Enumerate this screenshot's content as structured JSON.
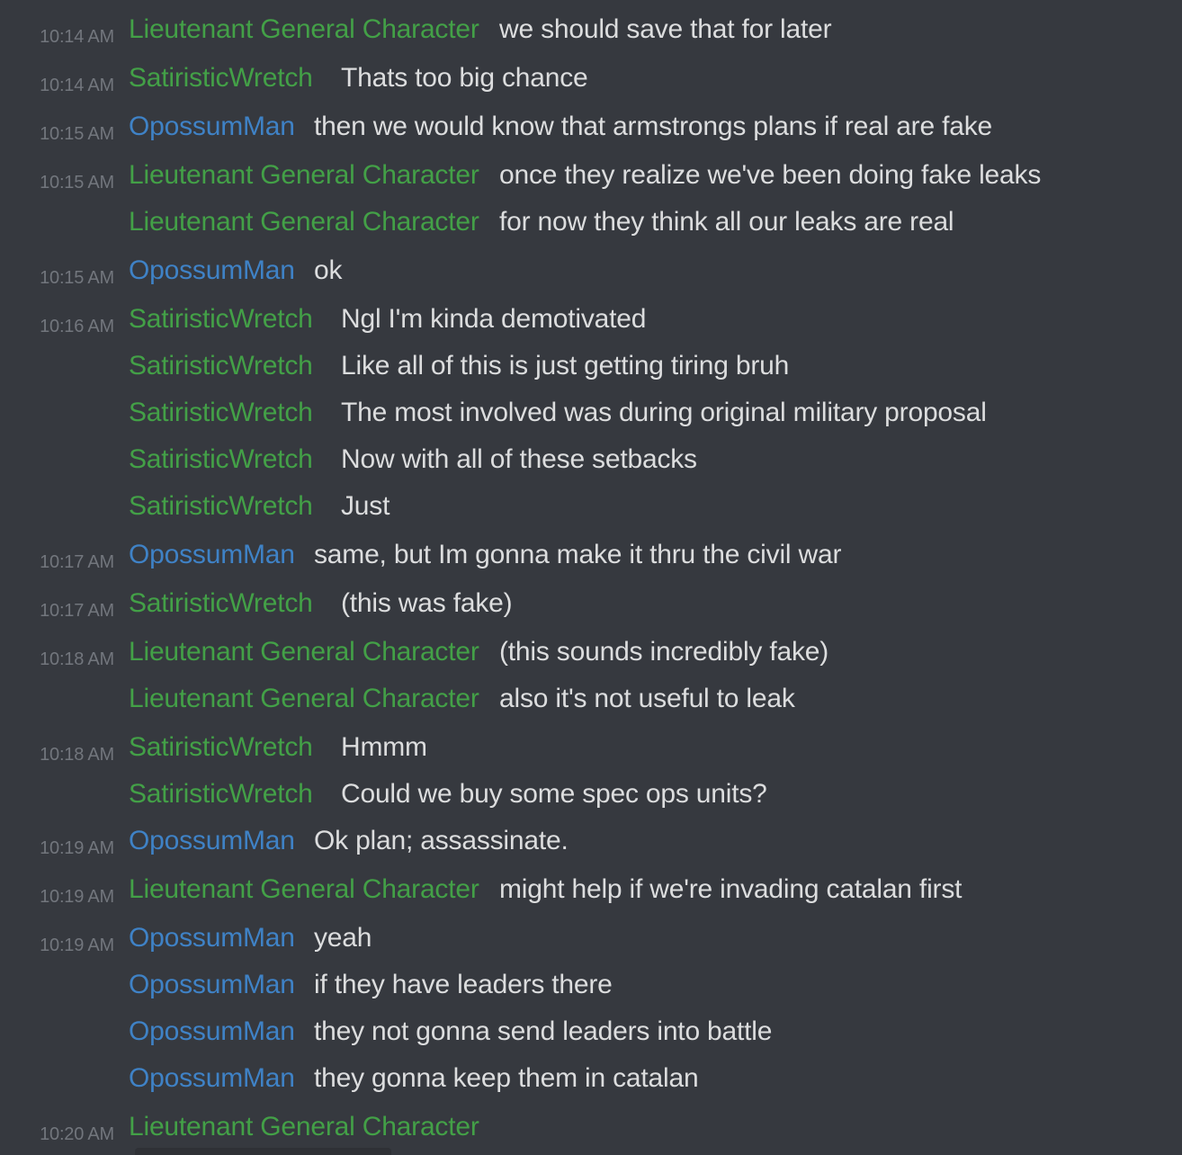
{
  "colors": {
    "background": "#36393f",
    "green_author": "#43a047",
    "blue_author": "#3f82c6",
    "timestamp": "#72767d",
    "text": "#dcddde"
  },
  "messages": [
    {
      "time": "10:14 AM",
      "author": "Lieutenant General Character",
      "color": "#43a047",
      "text": "we should save that for later"
    },
    {
      "time": "10:14 AM",
      "author": "SatiristicWretch",
      "color": "#43a047",
      "text": "Thats too big chance"
    },
    {
      "time": "10:15 AM",
      "author": "OpossumMan",
      "color": "#3f82c6",
      "text": "then we would know that armstrongs plans if real are fake"
    },
    {
      "time": "10:15 AM",
      "author": "Lieutenant General Character",
      "color": "#43a047",
      "text": "once they realize we've been doing fake leaks"
    },
    {
      "time": "",
      "author": "Lieutenant General Character",
      "color": "#43a047",
      "text": "for now they think all our leaks are real"
    },
    {
      "time": "10:15 AM",
      "author": "OpossumMan",
      "color": "#3f82c6",
      "text": "ok"
    },
    {
      "time": "10:16 AM",
      "author": "SatiristicWretch",
      "color": "#43a047",
      "text": "Ngl I'm kinda demotivated"
    },
    {
      "time": "",
      "author": "SatiristicWretch",
      "color": "#43a047",
      "text": "Like all of this is just getting tiring bruh"
    },
    {
      "time": "",
      "author": "SatiristicWretch",
      "color": "#43a047",
      "text": "The most involved was during original military proposal"
    },
    {
      "time": "",
      "author": "SatiristicWretch",
      "color": "#43a047",
      "text": "Now with all of these setbacks"
    },
    {
      "time": "",
      "author": "SatiristicWretch",
      "color": "#43a047",
      "text": "Just"
    },
    {
      "time": "10:17 AM",
      "author": "OpossumMan",
      "color": "#3f82c6",
      "text": "same, but Im gonna make it thru the civil war"
    },
    {
      "time": "10:17 AM",
      "author": "SatiristicWretch",
      "color": "#43a047",
      "text": "(this was fake)"
    },
    {
      "time": "10:18 AM",
      "author": "Lieutenant General Character",
      "color": "#43a047",
      "text": "(this sounds incredibly fake)"
    },
    {
      "time": "",
      "author": "Lieutenant General Character",
      "color": "#43a047",
      "text": "also it's not useful to leak"
    },
    {
      "time": "10:18 AM",
      "author": "SatiristicWretch",
      "color": "#43a047",
      "text": "Hmmm"
    },
    {
      "time": "",
      "author": "SatiristicWretch",
      "color": "#43a047",
      "text": "Could we buy some spec ops units?"
    },
    {
      "time": "10:19 AM",
      "author": "OpossumMan",
      "color": "#3f82c6",
      "text": "Ok plan; assassinate."
    },
    {
      "time": "10:19 AM",
      "author": "Lieutenant General Character",
      "color": "#43a047",
      "text": "might help if we're invading catalan first"
    },
    {
      "time": "10:19 AM",
      "author": "OpossumMan",
      "color": "#3f82c6",
      "text": "yeah"
    },
    {
      "time": "",
      "author": "OpossumMan",
      "color": "#3f82c6",
      "text": "if they have leaders there"
    },
    {
      "time": "",
      "author": "OpossumMan",
      "color": "#3f82c6",
      "text": "they not gonna send leaders into battle"
    },
    {
      "time": "",
      "author": "OpossumMan",
      "color": "#3f82c6",
      "text": "they gonna keep them in catalan"
    },
    {
      "time": "10:20 AM",
      "author": "Lieutenant General Character",
      "color": "#43a047",
      "text": ""
    }
  ]
}
